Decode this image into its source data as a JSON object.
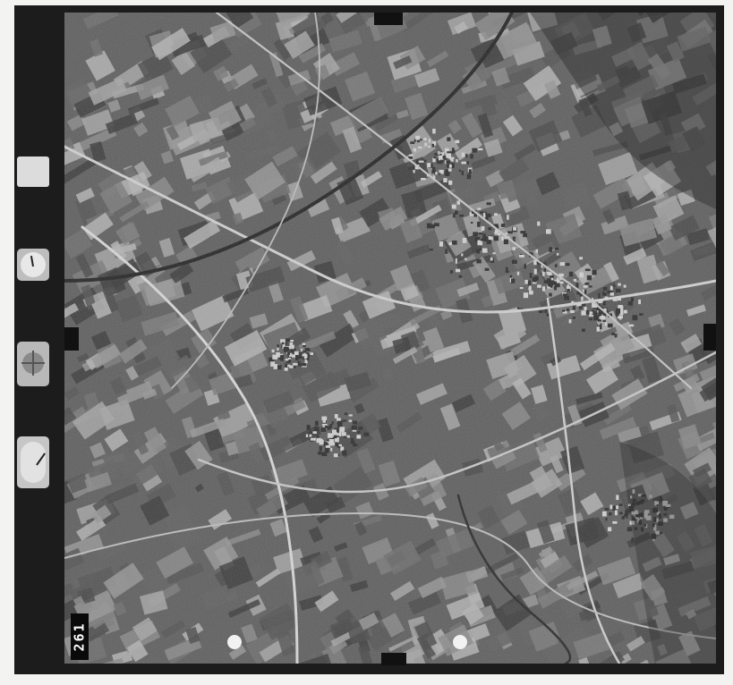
{
  "image": {
    "kind": "aerial-survey-photograph",
    "tone": "black-and-white"
  },
  "film_margin": {
    "frame_number": "261",
    "note_card_text": "",
    "level_card_text": ""
  },
  "colors": {
    "film_border": "#1c1c1c",
    "paper": "#f3f3f1",
    "field_dark": "#3e3e3e",
    "field_light": "#a8a8a8",
    "road": "#d0d0d0"
  },
  "icons": [
    "note-card-icon",
    "altimeter-icon",
    "level-bubble-icon",
    "clock-icon"
  ]
}
